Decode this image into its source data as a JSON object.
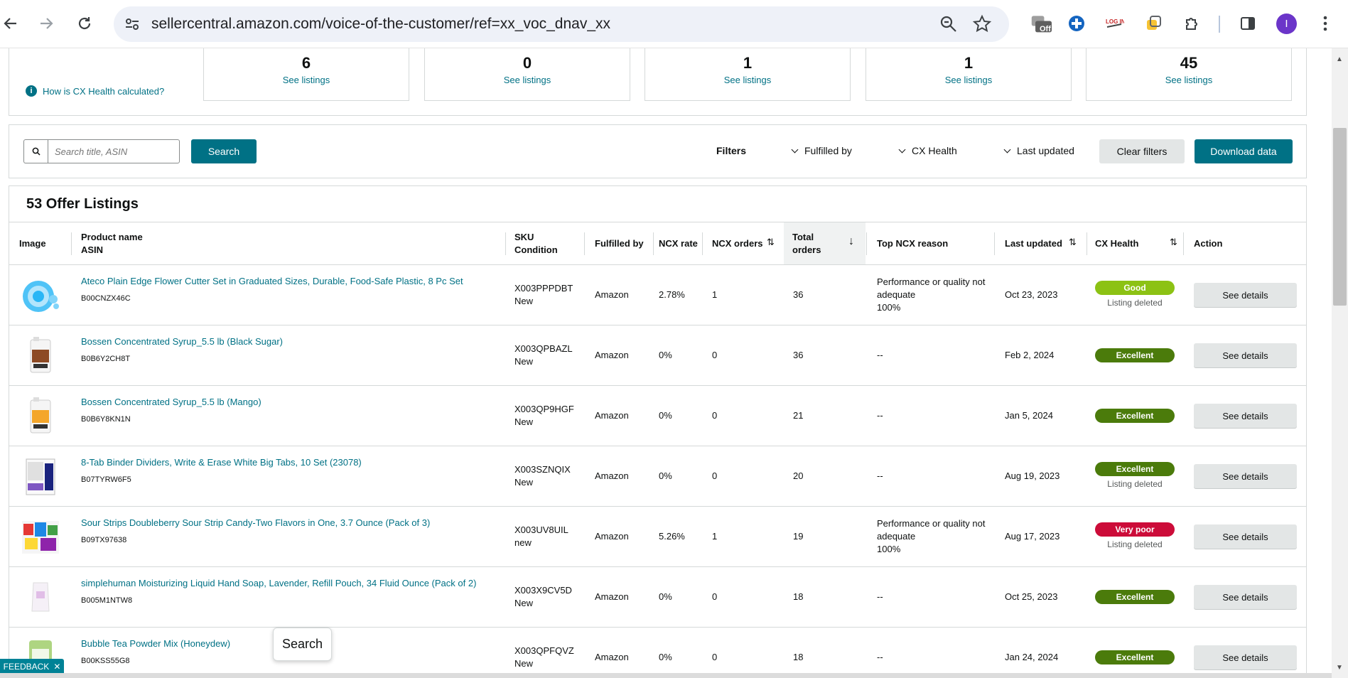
{
  "browser": {
    "url": "sellercentral.amazon.com/voice-of-the-customer/ref=xx_voc_dnav_xx",
    "avatar_letter": "I",
    "ext_off_label": "Off"
  },
  "summary": {
    "how_link": "How is CX Health calculated?",
    "cards": [
      {
        "count": "6",
        "link": "See listings"
      },
      {
        "count": "0",
        "link": "See listings"
      },
      {
        "count": "1",
        "link": "See listings"
      },
      {
        "count": "1",
        "link": "See listings"
      },
      {
        "count": "45",
        "link": "See listings"
      }
    ]
  },
  "filters": {
    "search_placeholder": "Search title, ASIN",
    "search_button": "Search",
    "filters_label": "Filters",
    "fulfilled_by": "Fulfilled by",
    "cx_health": "CX Health",
    "last_updated": "Last updated",
    "clear_filters": "Clear filters",
    "download_data": "Download data"
  },
  "listings": {
    "title": "53 Offer Listings",
    "headers": {
      "image": "Image",
      "product_name": "Product name",
      "asin": "ASIN",
      "sku": "SKU",
      "condition": "Condition",
      "fulfilled_by": "Fulfilled by",
      "ncx_rate": "NCX rate",
      "ncx_orders": "NCX orders",
      "total_orders_1": "Total",
      "total_orders_2": "orders",
      "top_ncx_reason": "Top NCX reason",
      "last_updated": "Last updated",
      "cx_health": "CX Health",
      "action": "Action"
    },
    "rows": [
      {
        "name": "Ateco Plain Edge Flower Cutter Set in Graduated Sizes, Durable, Food-Safe Plastic, 8 Pc Set",
        "asin": "B00CNZX46C",
        "sku": "X003PPPDBT",
        "condition": "New",
        "fulfilled": "Amazon",
        "ncx_rate": "2.78%",
        "ncx_orders": "1",
        "total": "36",
        "reason_1": "Performance or quality not",
        "reason_2": "adequate",
        "reason_3": "100%",
        "updated": "Oct 23, 2023",
        "health": "Good",
        "health_color": "#8cc214",
        "deleted": "Listing deleted",
        "action": "See details"
      },
      {
        "name": "Bossen Concentrated Syrup_5.5 lb (Black Sugar)",
        "asin": "B0B6Y2CH8T",
        "sku": "X003QPBAZL",
        "condition": "New",
        "fulfilled": "Amazon",
        "ncx_rate": "0%",
        "ncx_orders": "0",
        "total": "36",
        "reason_1": "--",
        "reason_2": "",
        "reason_3": "",
        "updated": "Feb 2, 2024",
        "health": "Excellent",
        "health_color": "#4b7b0b",
        "deleted": "",
        "action": "See details"
      },
      {
        "name": "Bossen Concentrated Syrup_5.5 lb (Mango)",
        "asin": "B0B6Y8KN1N",
        "sku": "X003QP9HGF",
        "condition": "New",
        "fulfilled": "Amazon",
        "ncx_rate": "0%",
        "ncx_orders": "0",
        "total": "21",
        "reason_1": "--",
        "reason_2": "",
        "reason_3": "",
        "updated": "Jan 5, 2024",
        "health": "Excellent",
        "health_color": "#4b7b0b",
        "deleted": "",
        "action": "See details"
      },
      {
        "name": "8-Tab Binder Dividers, Write & Erase White Big Tabs, 10 Set (23078)",
        "asin": "B07TYRW6F5",
        "sku": "X003SZNQIX",
        "condition": "New",
        "fulfilled": "Amazon",
        "ncx_rate": "0%",
        "ncx_orders": "0",
        "total": "20",
        "reason_1": "--",
        "reason_2": "",
        "reason_3": "",
        "updated": "Aug 19, 2023",
        "health": "Excellent",
        "health_color": "#4b7b0b",
        "deleted": "Listing deleted",
        "action": "See details"
      },
      {
        "name": "Sour Strips Doubleberry Sour Strip Candy-Two Flavors in One, 3.7 Ounce (Pack of 3)",
        "asin": "B09TX97638",
        "sku": "X003UV8UIL",
        "condition": "new",
        "fulfilled": "Amazon",
        "ncx_rate": "5.26%",
        "ncx_orders": "1",
        "total": "19",
        "reason_1": "Performance or quality not",
        "reason_2": "adequate",
        "reason_3": "100%",
        "updated": "Aug 17, 2023",
        "health": "Very poor",
        "health_color": "#cc0c39",
        "deleted": "Listing deleted",
        "action": "See details"
      },
      {
        "name": "simplehuman Moisturizing Liquid Hand Soap, Lavender, Refill Pouch, 34 Fluid Ounce (Pack of 2)",
        "asin": "B005M1NTW8",
        "sku": "X003X9CV5D",
        "condition": "New",
        "fulfilled": "Amazon",
        "ncx_rate": "0%",
        "ncx_orders": "0",
        "total": "18",
        "reason_1": "--",
        "reason_2": "",
        "reason_3": "",
        "updated": "Oct 25, 2023",
        "health": "Excellent",
        "health_color": "#4b7b0b",
        "deleted": "",
        "action": "See details"
      },
      {
        "name": "Bubble Tea Powder Mix (Honeydew)",
        "asin": "B00KSS55G8",
        "sku": "X003QPFQVZ",
        "condition": "New",
        "fulfilled": "Amazon",
        "ncx_rate": "0%",
        "ncx_orders": "0",
        "total": "18",
        "reason_1": "--",
        "reason_2": "",
        "reason_3": "",
        "updated": "Jan 24, 2024",
        "health": "Excellent",
        "health_color": "#4b7b0b",
        "deleted": "",
        "action": "See details"
      }
    ]
  },
  "tooltip": "Search",
  "feedback": {
    "label": "FEEDBACK",
    "close": "✕"
  }
}
